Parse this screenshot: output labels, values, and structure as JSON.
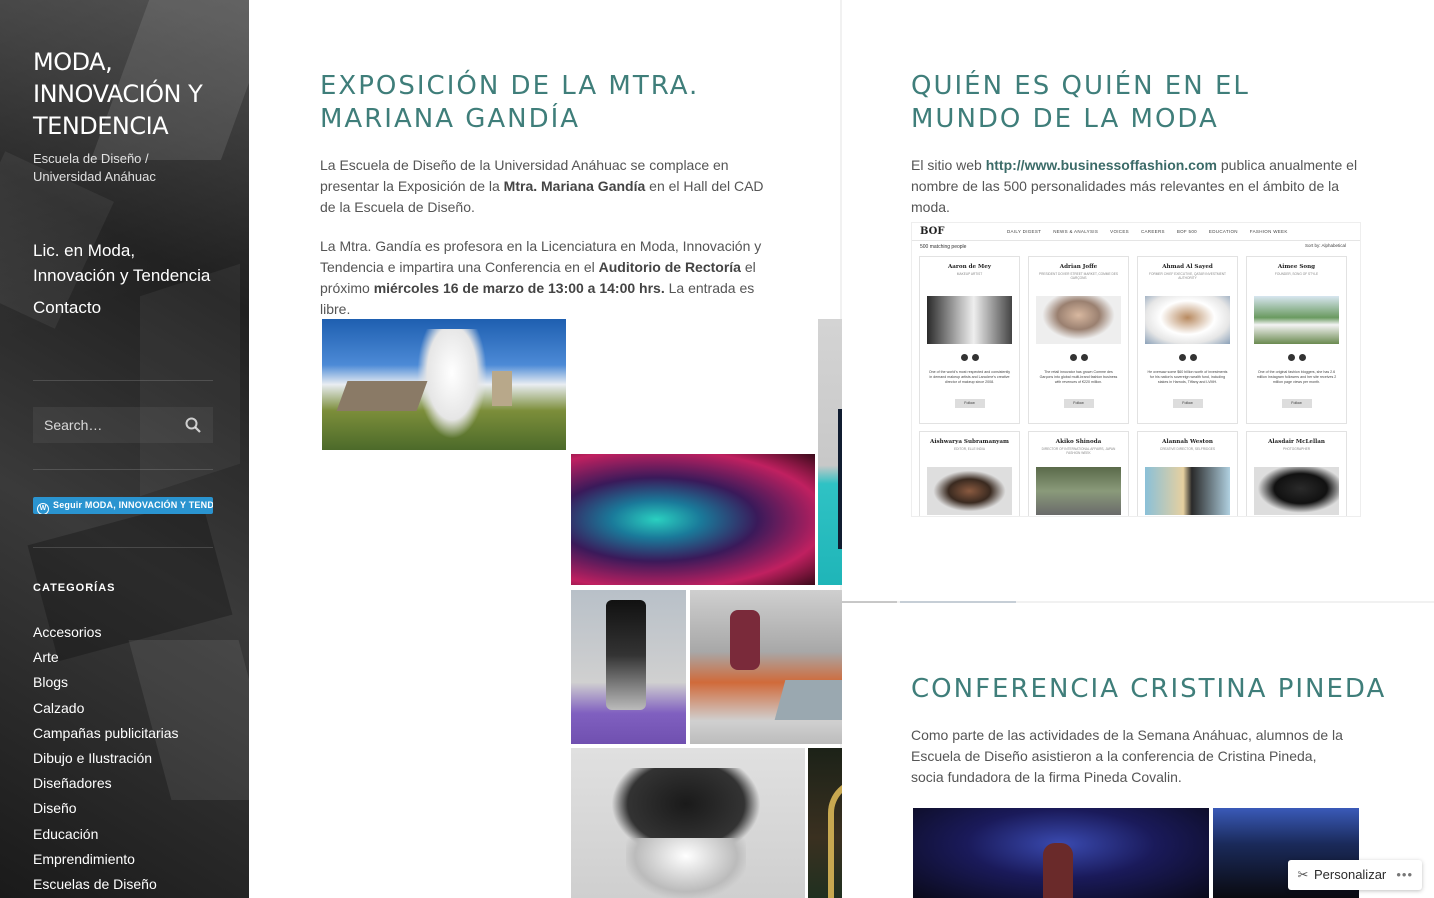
{
  "site": {
    "title": "MODA, INNOVACIÓN Y TENDENCIA",
    "description": "Escuela de Diseño / Universidad Anáhuac"
  },
  "nav": {
    "items": [
      {
        "label": "Lic. en Moda, Innovación y Tendencia"
      },
      {
        "label": "Contacto"
      }
    ]
  },
  "search": {
    "placeholder": "Search…"
  },
  "follow": {
    "label": "Seguir MODA, INNOVACIÓN Y TENDENCIA"
  },
  "categories": {
    "heading": "CATEGORÍAS",
    "items": [
      "Accesorios",
      "Arte",
      "Blogs",
      "Calzado",
      "Campañas publicitarias",
      "Dibujo e Ilustración",
      "Diseñadores",
      "Diseño",
      "Educación",
      "Emprendimiento",
      "Escuelas de Diseño"
    ]
  },
  "posts": {
    "expo": {
      "title": "EXPOSICIÓN DE LA MTRA. MARIANA GANDÍA",
      "p1_a": "La Escuela de Diseño de la Universidad Anáhuac se complace en presentar la Exposición de la ",
      "p1_b": "Mtra. Mariana Gandía",
      "p1_c": " en el Hall del CAD de la Escuela de Diseño.",
      "p2_a": "La Mtra. Gandía es profesora en la Licenciatura en Moda, Innovación y Tendencia e impartira una Conferencia en el ",
      "p2_b": "Auditorio de Rectoría",
      "p2_c": " el próximo ",
      "p2_d": "miércoles 16 de marzo de 13:00 a 14:00 hrs.",
      "p2_e": " La entrada es libre."
    },
    "quien": {
      "title": "QUIÉN ES QUIÉN EN EL MUNDO DE LA MODA",
      "p1_a": "El sitio web ",
      "p1_link": "http://www.businessoffashion.com",
      "p1_c": " publica anualmente el nombre de las 500 personalidades más relevantes en el ámbito de la moda."
    },
    "conferencia": {
      "title": "CONFERENCIA CRISTINA PINEDA",
      "p1": "Como parte de las actividades de la Semana Anáhuac, alumnos de la Escuela de Diseño asistieron a la conferencia de Cristina Pineda, socia fundadora de la firma Pineda Covalin."
    }
  },
  "bof": {
    "logo": "BOF",
    "nav": [
      "DAILY DIGEST",
      "NEWS & ANALYSIS",
      "VOICES",
      "CAREERS",
      "BOF 500",
      "EDUCATION",
      "FASHION WEEK"
    ],
    "count": "500 matching people",
    "sort_label": "Sort by:",
    "sort_value": "Alphabetical",
    "follow": "Follow",
    "people": [
      {
        "name": "Aaron de Mey",
        "role": "MAKEUP ARTIST",
        "desc": "One of the world's most respected and consistently in demand makeup artists and Lancôme's creative director of makeup since 2008."
      },
      {
        "name": "Adrian Joffe",
        "role": "PRESIDENT DOVER STREET MARKET, COMME DES GARÇONS",
        "desc": "The retail innovator has grown Comme des Garçons into global multi-brand fashion business with revenues of €220 million."
      },
      {
        "name": "Ahmad Al Sayed",
        "role": "FORMER CHIEF EXECUTIVE, QATAR INVESTMENT AUTHORITY",
        "desc": "He oversaw some $60 billion worth of investments for his nation's sovereign wealth fund, including stakes in Harrods, Tiffany and LVMH."
      },
      {
        "name": "Aimee Song",
        "role": "FOUNDER, SONG OF STYLE",
        "desc": "One of the original fashion bloggers, she has 2.6 million Instagram followers and her site receives 2 million page views per month."
      },
      {
        "name": "Aishwarya Subramanyam",
        "role": "EDITOR, ELLE INDIA",
        "desc": ""
      },
      {
        "name": "Akiko Shinoda",
        "role": "DIRECTOR OF INTERNATIONAL AFFAIRS, JAPAN FASHION WEEK",
        "desc": ""
      },
      {
        "name": "Alannah Weston",
        "role": "CREATIVE DIRECTOR, SELFRIDGES",
        "desc": ""
      },
      {
        "name": "Alasdair McLellan",
        "role": "PHOTOGRAPHER",
        "desc": ""
      }
    ]
  },
  "personalize": {
    "label": "Personalizar",
    "more": "•••"
  }
}
